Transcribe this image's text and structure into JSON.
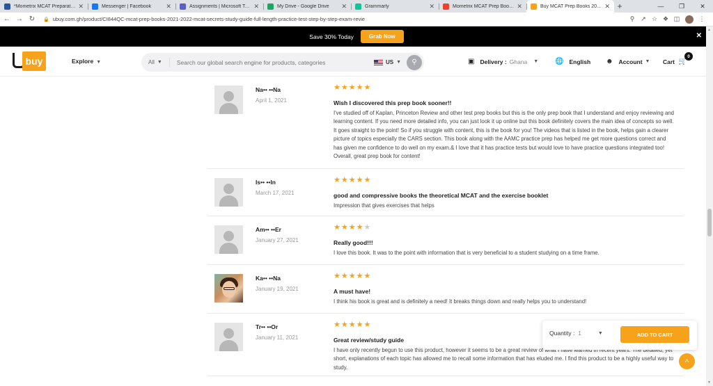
{
  "browser": {
    "tabs": [
      {
        "title": "*Mometrix MCAT Preparation Bo",
        "favicon_color": "#2b579a"
      },
      {
        "title": "Messenger | Facebook",
        "favicon_color": "#1877f2"
      },
      {
        "title": "Assignments | Microsoft Teams",
        "favicon_color": "#5b5fc7"
      },
      {
        "title": "My Drive - Google Drive",
        "favicon_color": "#1fa463"
      },
      {
        "title": "Grammarly",
        "favicon_color": "#15c39a"
      },
      {
        "title": "Mometrix MCAT Prep Books cur",
        "favicon_color": "#ea4335"
      },
      {
        "title": "Buy MCAT Prep Books 2021-202",
        "favicon_color": "#f7a21b"
      }
    ],
    "url": "ubuy.com.gh/product/CI844QC-mcat-prep-books-2021-2022-mcat-secrets-study-guide-full-length-practice-test-step-by-step-exam-revie"
  },
  "promo": {
    "text": "Save 30% Today",
    "button": "Grab Now"
  },
  "header": {
    "logo": "buy",
    "explore": "Explore",
    "search_scope": "All",
    "search_placeholder": "Search our global search engine for products, categories",
    "country": "US",
    "delivery_label": "Delivery :",
    "delivery_country": "Ghana",
    "language": "English",
    "account": "Account",
    "cart": "Cart",
    "cart_count": "0"
  },
  "reviews": [
    {
      "name": "Na•• ••Na",
      "date": "April 1, 2021",
      "rating": 5,
      "title": "Wish I discovered this prep book sooner!!",
      "body": "I've studied off of Kaplan, Princeton Review and other test prep books but this is the only prep book that I understand and enjoy reviewing and learning content. If you need more detailed info, you can just look it up online but this book definitely covers the main idea of concepts so well. It goes straight to the point! So if you struggle with content, this is the book for you! The videos that is listed in the book, helps gain a clearer picture of topics especially the CARS section. This book along with the AAMC practice prep has helped me get more questions correct and has given me confidence to do well on my exam.& I love that it has practice tests but would love to have practice questions integrated too! Overall, great prep book for content!",
      "avatar": "placeholder"
    },
    {
      "name": "Is•• ••In",
      "date": "March 17, 2021",
      "rating": 5,
      "title": "good and compressive books the theoretical MCAT and the exercise booklet",
      "body": "Impression that gives exercises that helps",
      "avatar": "placeholder"
    },
    {
      "name": "Am•• ••Er",
      "date": "January 27, 2021",
      "rating": 4,
      "title": "Really good!!!",
      "body": "I love this book. It was to the point with information that is very beneficial to a student studying on a time frame.",
      "avatar": "placeholder"
    },
    {
      "name": "Ka•• ••Na",
      "date": "January 19, 2021",
      "rating": 5,
      "title": "A must have!",
      "body": "I think his book is great and is definitely a need! It breaks things down and really helps you to understand!",
      "avatar": "photo"
    },
    {
      "name": "Tr•• ••Or",
      "date": "January 11, 2021",
      "rating": 5,
      "title": "Great review/study guide",
      "body": "I have only recently begun to use this product, however it seems to be a great review of what I have learned in recent years. The detailed, yet short, explanations of each topic has allowed me to recall some information that has eluded me. I find this product to be a highly useful way to study.",
      "avatar": "placeholder"
    }
  ],
  "sticky_cart": {
    "quantity_label": "Quantity :",
    "quantity_value": "1",
    "add_to_cart": "ADD TO CART"
  },
  "colors": {
    "accent": "#f7a21b",
    "promo_bg": "#000000"
  }
}
